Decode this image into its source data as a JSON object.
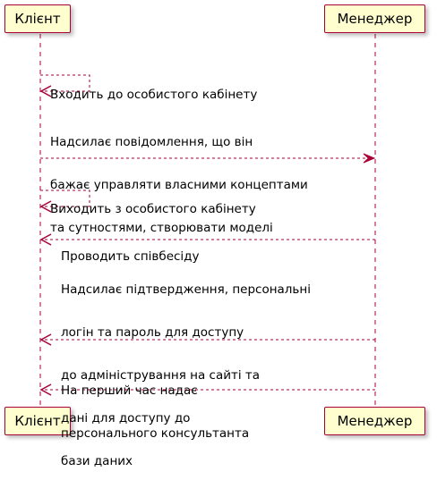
{
  "participants": {
    "client": "Клієнт",
    "manager": "Менеджер"
  },
  "messages": [
    {
      "from": "client",
      "to": "client",
      "lines": [
        "Входить до особистого кабінету"
      ]
    },
    {
      "from": "client",
      "to": "manager",
      "lines": [
        "Надсилає повідомлення, що він",
        "бажає управляти власними концептами",
        "та сутностями, створювати моделі"
      ]
    },
    {
      "from": "client",
      "to": "client",
      "lines": [
        "Виходить з особистого кабінету"
      ]
    },
    {
      "from": "manager",
      "to": "client",
      "lines": [
        "Проводить співбесіду"
      ]
    },
    {
      "from": "manager",
      "to": "client",
      "lines": [
        "Надсилає підтвердження, персональні",
        "логін та пароль для доступу",
        "до адміністрування на сайті та",
        "дані для доступу до",
        "бази даних"
      ]
    },
    {
      "from": "manager",
      "to": "client",
      "lines": [
        "На перший час надає",
        "персонального консультанта"
      ]
    }
  ],
  "colors": {
    "box_fill": "#fefece",
    "box_border": "#a80036",
    "line": "#a80036"
  }
}
